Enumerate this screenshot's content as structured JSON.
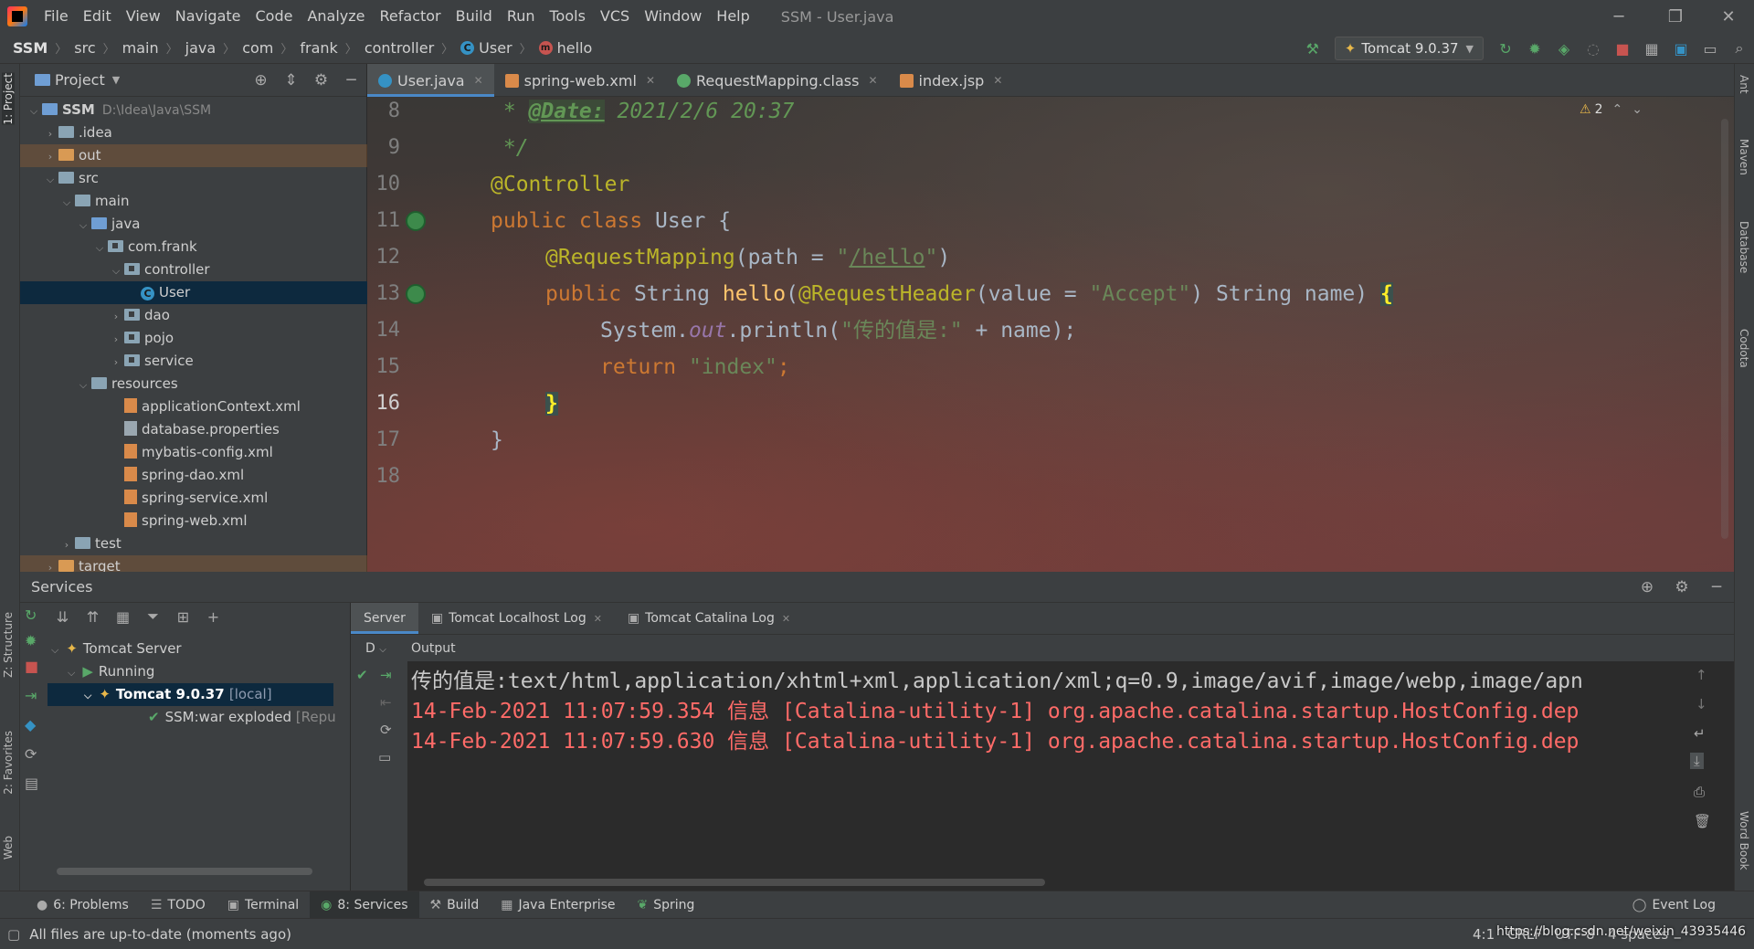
{
  "window": {
    "title": "SSM - User.java",
    "menu": [
      "File",
      "Edit",
      "View",
      "Navigate",
      "Code",
      "Analyze",
      "Refactor",
      "Build",
      "Run",
      "Tools",
      "VCS",
      "Window",
      "Help"
    ]
  },
  "breadcrumb": [
    "SSM",
    "src",
    "main",
    "java",
    "com",
    "frank",
    "controller",
    "User",
    "hello"
  ],
  "run_config": "Tomcat 9.0.37",
  "project_panel": {
    "title": "Project",
    "tree": [
      {
        "label": "SSM",
        "path": "D:\\Idea\\Java\\SSM",
        "icon": "folder-icon"
      },
      {
        "label": ".idea",
        "icon": "folder-icon"
      },
      {
        "label": "out",
        "icon": "folder-icon"
      },
      {
        "label": "src",
        "icon": "folder-icon"
      },
      {
        "label": "main",
        "icon": "folder-icon"
      },
      {
        "label": "java",
        "icon": "folder-icon"
      },
      {
        "label": "com.frank",
        "icon": "package-icon"
      },
      {
        "label": "controller",
        "icon": "package-icon"
      },
      {
        "label": "User",
        "icon": "class-icon"
      },
      {
        "label": "dao",
        "icon": "package-icon"
      },
      {
        "label": "pojo",
        "icon": "package-icon"
      },
      {
        "label": "service",
        "icon": "package-icon"
      },
      {
        "label": "resources",
        "icon": "folder-icon"
      },
      {
        "label": "applicationContext.xml",
        "icon": "xml-icon"
      },
      {
        "label": "database.properties",
        "icon": "properties-icon"
      },
      {
        "label": "mybatis-config.xml",
        "icon": "xml-icon"
      },
      {
        "label": "spring-dao.xml",
        "icon": "xml-icon"
      },
      {
        "label": "spring-service.xml",
        "icon": "xml-icon"
      },
      {
        "label": "spring-web.xml",
        "icon": "xml-icon"
      },
      {
        "label": "test",
        "icon": "folder-icon"
      },
      {
        "label": "target",
        "icon": "folder-icon"
      }
    ]
  },
  "editor": {
    "tabs": [
      {
        "label": "User.java",
        "active": true
      },
      {
        "label": "spring-web.xml",
        "active": false
      },
      {
        "label": "RequestMapping.class",
        "active": false
      },
      {
        "label": "index.jsp",
        "active": false
      }
    ],
    "inspection_count": "2",
    "line_numbers": [
      "8",
      "9",
      "10",
      "11",
      "12",
      "13",
      "14",
      "15",
      "16",
      "17",
      "18"
    ],
    "code": {
      "l8_prefix": " * ",
      "l8_tag": "@Date:",
      "l8_rest": " 2021/2/6 20:37",
      "l9": " */",
      "l10": "@Controller",
      "l11_kw": "public class",
      "l11_rest": " User {",
      "l12_ann": "@RequestMapping",
      "l12_open": "(path = ",
      "l12_q1": "\"",
      "l12_path": "/hello",
      "l12_q2": "\"",
      "l12_close": ")",
      "l13_kw": "public",
      "l13_type": " String ",
      "l13_fn": "hello",
      "l13_paren": "(",
      "l13_ann": "@RequestHeader",
      "l13_args": "(value = ",
      "l13_str": "\"Accept\"",
      "l13_tail": ") String name) ",
      "l13_brace": "{",
      "l14_obj": "System.",
      "l14_field": "out",
      "l14_call": ".println(",
      "l14_str": "\"传的值是:\"",
      "l14_tail": " + name);",
      "l15_kw": "return",
      "l15_str": " \"index\"",
      "l15_semi": ";",
      "l16": "}",
      "l17": "}"
    }
  },
  "services": {
    "title": "Services",
    "tree": [
      {
        "label": "Tomcat Server"
      },
      {
        "label": "Running"
      },
      {
        "label": "Tomcat 9.0.37",
        "suffix": "[local]"
      },
      {
        "label": "SSM:war exploded",
        "suffix": "[Repu"
      }
    ],
    "tabs": [
      "Server",
      "Tomcat Localhost Log",
      "Tomcat Catalina Log"
    ],
    "sub_label_d": "D",
    "output_label": "Output",
    "console": [
      "传的值是:text/html,application/xhtml+xml,application/xml;q=0.9,image/avif,image/webp,image/apn",
      "14-Feb-2021 11:07:59.354 信息 [Catalina-utility-1] org.apache.catalina.startup.HostConfig.dep",
      "14-Feb-2021 11:07:59.630 信息 [Catalina-utility-1] org.apache.catalina.startup.HostConfig.dep"
    ]
  },
  "left_stripe": [
    "1: Project",
    "Z: Structure",
    "2: Favorites",
    "Web"
  ],
  "right_stripe": [
    "Ant",
    "Maven",
    "Database",
    "Codota",
    "Word Book"
  ],
  "bottom_tools": [
    {
      "label": "6: Problems",
      "icon": "problems-icon"
    },
    {
      "label": "TODO",
      "icon": "todo-icon"
    },
    {
      "label": "Terminal",
      "icon": "terminal-icon"
    },
    {
      "label": "8: Services",
      "icon": "services-icon",
      "active": true
    },
    {
      "label": "Build",
      "icon": "build-icon"
    },
    {
      "label": "Java Enterprise",
      "icon": "java-enterprise-icon"
    },
    {
      "label": "Spring",
      "icon": "spring-icon"
    }
  ],
  "event_log": "Event Log",
  "status": {
    "message": "All files are up-to-date (moments ago)",
    "position": "4:1",
    "line_sep": "CRLF",
    "encoding": "UTF-8",
    "indent": "4 spaces",
    "watermark": "https://blog.csdn.net/weixin_43935446"
  },
  "colors": {
    "accent": "#4a88c7",
    "keyword": "#cc7832",
    "annotation": "#bbb529",
    "string": "#6a8759",
    "error_text": "#ff6b68"
  }
}
